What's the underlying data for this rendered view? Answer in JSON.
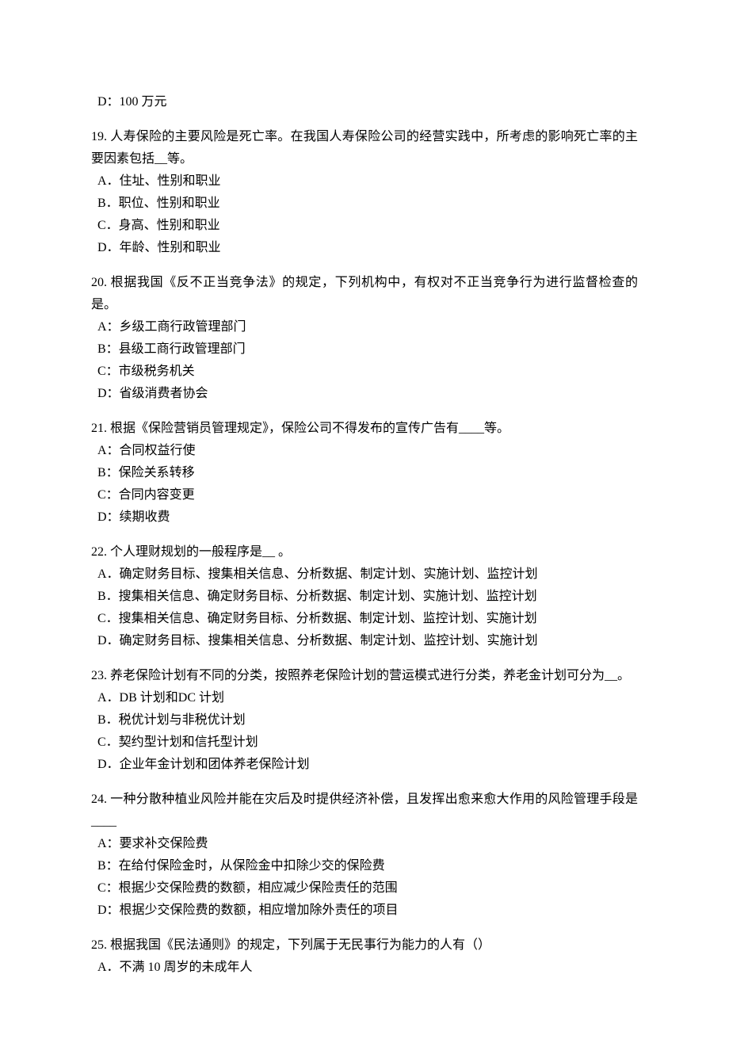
{
  "q18": {
    "opt_d": "D：100 万元"
  },
  "q19": {
    "stem": "19. 人寿保险的主要风险是死亡率。在我国人寿保险公司的经营实践中，所考虑的影响死亡率的主要因素包括__等。",
    "a": "A．住址、性别和职业",
    "b": "B．职位、性别和职业",
    "c": "C．身高、性别和职业",
    "d": "D．年龄、性别和职业"
  },
  "q20": {
    "stem": "20. 根据我国《反不正当竞争法》的规定，下列机构中，有权对不正当竞争行为进行监督检查的是。",
    "a": "A：乡级工商行政管理部门",
    "b": "B：县级工商行政管理部门",
    "c": "C：市级税务机关",
    "d": "D：省级消费者协会"
  },
  "q21": {
    "stem": "21. 根据《保险营销员管理规定》，保险公司不得发布的宣传广告有____等。",
    "a": "A：合同权益行使",
    "b": "B：保险关系转移",
    "c": "C：合同内容变更",
    "d": "D：续期收费"
  },
  "q22": {
    "stem": "22. 个人理财规划的一般程序是__ 。",
    "a": "A．确定财务目标、搜集相关信息、分析数据、制定计划、实施计划、监控计划",
    "b": "B．搜集相关信息、确定财务目标、分析数据、制定计划、实施计划、监控计划",
    "c": "C．搜集相关信息、确定财务目标、分析数据、制定计划、监控计划、实施计划",
    "d": "D．确定财务目标、搜集相关信息、分析数据、制定计划、监控计划、实施计划"
  },
  "q23": {
    "stem": "23. 养老保险计划有不同的分类，按照养老保险计划的营运模式进行分类，养老金计划可分为__。",
    "a": "A．DB 计划和DC 计划",
    "b": "B．税优计划与非税优计划",
    "c": "C．契约型计划和信托型计划",
    "d": "D．企业年金计划和团体养老保险计划"
  },
  "q24": {
    "stem": "24. 一种分散种植业风险并能在灾后及时提供经济补偿，且发挥出愈来愈大作用的风险管理手段是____",
    "a": "A：要求补交保险费",
    "b": "B：在给付保险金时，从保险金中扣除少交的保险费",
    "c": "C：根据少交保险费的数额，相应减少保险责任的范围",
    "d": "D：根据少交保险费的数额，相应增加除外责任的项目"
  },
  "q25": {
    "stem": "25. 根据我国《民法通则》的规定，下列属于无民事行为能力的人有（）",
    "a": "A．不满 10 周岁的未成年人"
  }
}
